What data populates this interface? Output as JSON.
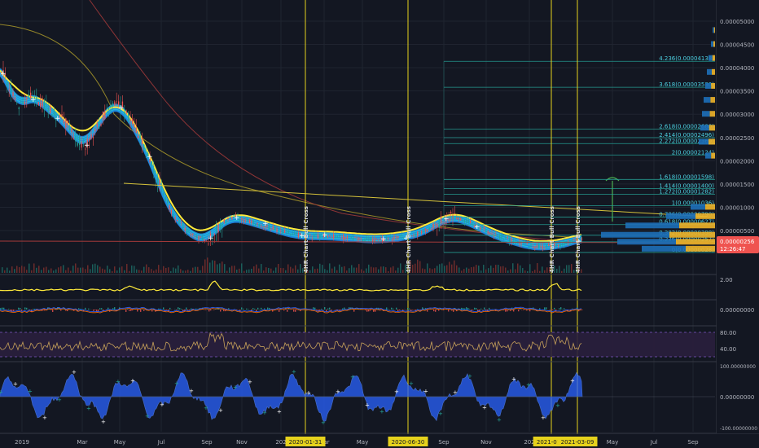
{
  "price_axis": {
    "labels": [
      "0.00005000",
      "0.00004500",
      "0.00004000",
      "0.00003500",
      "0.00003000",
      "0.00002500",
      "0.00002000",
      "0.00001500",
      "0.00001000",
      "0.00000500"
    ],
    "current_price": "0.00000256",
    "countdown": "12:26:47",
    "price_color": "#ef5350"
  },
  "fib_levels": [
    {
      "label": "4.236(0.00004138)",
      "value": 4.138
    },
    {
      "label": "3.618(0.00003580)",
      "value": 3.58
    },
    {
      "label": "2.618(0.00002680)",
      "value": 2.68
    },
    {
      "label": "2.414(0.00002496)",
      "value": 2.496
    },
    {
      "label": "2.272(0.00002369)",
      "value": 2.369
    },
    {
      "label": "2(0.00002124)",
      "value": 2.124
    },
    {
      "label": "1.618(0.00001598)",
      "value": 1.598
    },
    {
      "label": "1.414(0.00001400)",
      "value": 1.4
    },
    {
      "label": "1.272(0.00001282)",
      "value": 1.282
    },
    {
      "label": "1(0.00001036)",
      "value": 1.036
    },
    {
      "label": "0.786(0.00000790)",
      "value": 0.79
    },
    {
      "label": "0.618(0.00000627)",
      "value": 0.627
    },
    {
      "label": "0.382(0.00000398)",
      "value": 0.398
    },
    {
      "label": "0.236(0.00000257)",
      "value": 0.257
    },
    {
      "label": "0(0.00000028)",
      "value": 0.028
    }
  ],
  "vertical_markers": [
    {
      "text": "4HR Chart Bull Cross",
      "date": "2020-01-31"
    },
    {
      "text": "4HR Chart Bull Cross",
      "date": "2020-06-30"
    },
    {
      "text": "4HR Chart Bull Cross",
      "date": "2021-01-2"
    },
    {
      "text": "4HR Chart Bull Cross",
      "date": "2021-03-09"
    }
  ],
  "time_axis": [
    "2019",
    "Mar",
    "May",
    "Jul",
    "Sep",
    "Nov",
    "202",
    "Mar",
    "May",
    "Sep",
    "Nov",
    "202",
    "May",
    "Jul",
    "Sep"
  ],
  "indicators": {
    "panel1_label": "2.00",
    "panel2_label": "0.00000000",
    "rsi_labels": [
      "80.00",
      "40.00"
    ],
    "osc_labels": [
      "100.00000000",
      "0.00000000",
      "-100.00000000"
    ]
  },
  "colors": {
    "background": "#131722",
    "fib_line": "#26a69a",
    "fib_text": "#4dd0e1",
    "marker_line": "#e6d21c",
    "ribbon_blue": "#1e88e5",
    "ribbon_cyan": "#26c6da",
    "ribbon_yellow": "#ffeb3b",
    "volume_profile": "#f0b429"
  }
}
